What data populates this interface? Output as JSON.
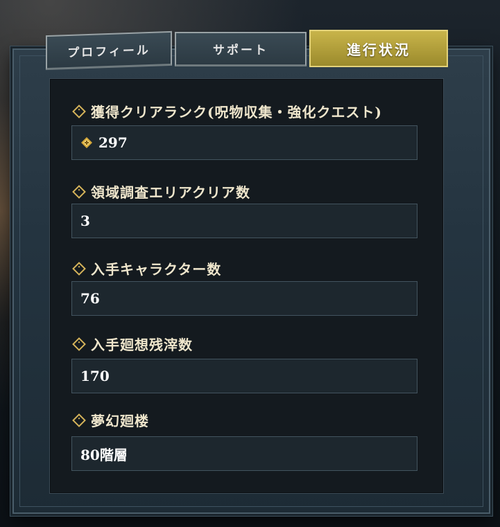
{
  "tabs": [
    {
      "label": "プロフィール",
      "active": false
    },
    {
      "label": "サポート",
      "active": false
    },
    {
      "label": "進行状況",
      "active": true
    }
  ],
  "stats": [
    {
      "label": "獲得クリアランク(呪物収集・強化クエスト)",
      "value": "297",
      "icon": "rank-icon"
    },
    {
      "label": "領域調査エリアクリア数",
      "value": "3"
    },
    {
      "label": "入手キャラクター数",
      "value": "76"
    },
    {
      "label": "入手廻想残滓数",
      "value": "170"
    },
    {
      "label": "夢幻廻楼",
      "value": "80階層"
    }
  ],
  "colors": {
    "accent_gold": "#d6b45a",
    "active_tab": "#b8a23a",
    "panel": "#141a1f"
  }
}
